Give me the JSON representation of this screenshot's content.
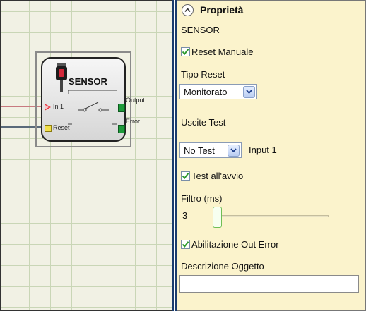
{
  "canvas": {
    "block": {
      "title": "SENSOR",
      "ports": {
        "in1": "In 1",
        "reset": "Reset",
        "output": "Output",
        "error": "Error"
      }
    }
  },
  "panel": {
    "title": "Proprietà",
    "object_name": "SENSOR",
    "reset_manuale": {
      "label": "Reset Manuale",
      "checked": true
    },
    "tipo_reset": {
      "label": "Tipo Reset",
      "value": "Monitorato"
    },
    "uscite_test": {
      "label": "Uscite Test",
      "value": "No Test",
      "input_label": "Input 1"
    },
    "test_avvio": {
      "label": "Test all'avvio",
      "checked": true
    },
    "filtro": {
      "label": "Filtro (ms)",
      "value": "3"
    },
    "out_error": {
      "label": "Abilitazione Out Error",
      "checked": true
    },
    "descrizione": {
      "label": "Descrizione Oggetto",
      "value": ""
    }
  },
  "colors": {
    "panel_bg": "#fbf3cc",
    "canvas_bg": "#f1f1e4",
    "check_green": "#2e9a2e",
    "port_input": "#e8323c",
    "port_reset": "#f2e04a",
    "port_output": "#1e9a3a"
  },
  "icons": {
    "collapse": "chevron-up-circle-icon",
    "sensor": "photoelectric-sensor-icon",
    "dropdown": "chevron-down-icon",
    "check": "checkmark-icon"
  }
}
